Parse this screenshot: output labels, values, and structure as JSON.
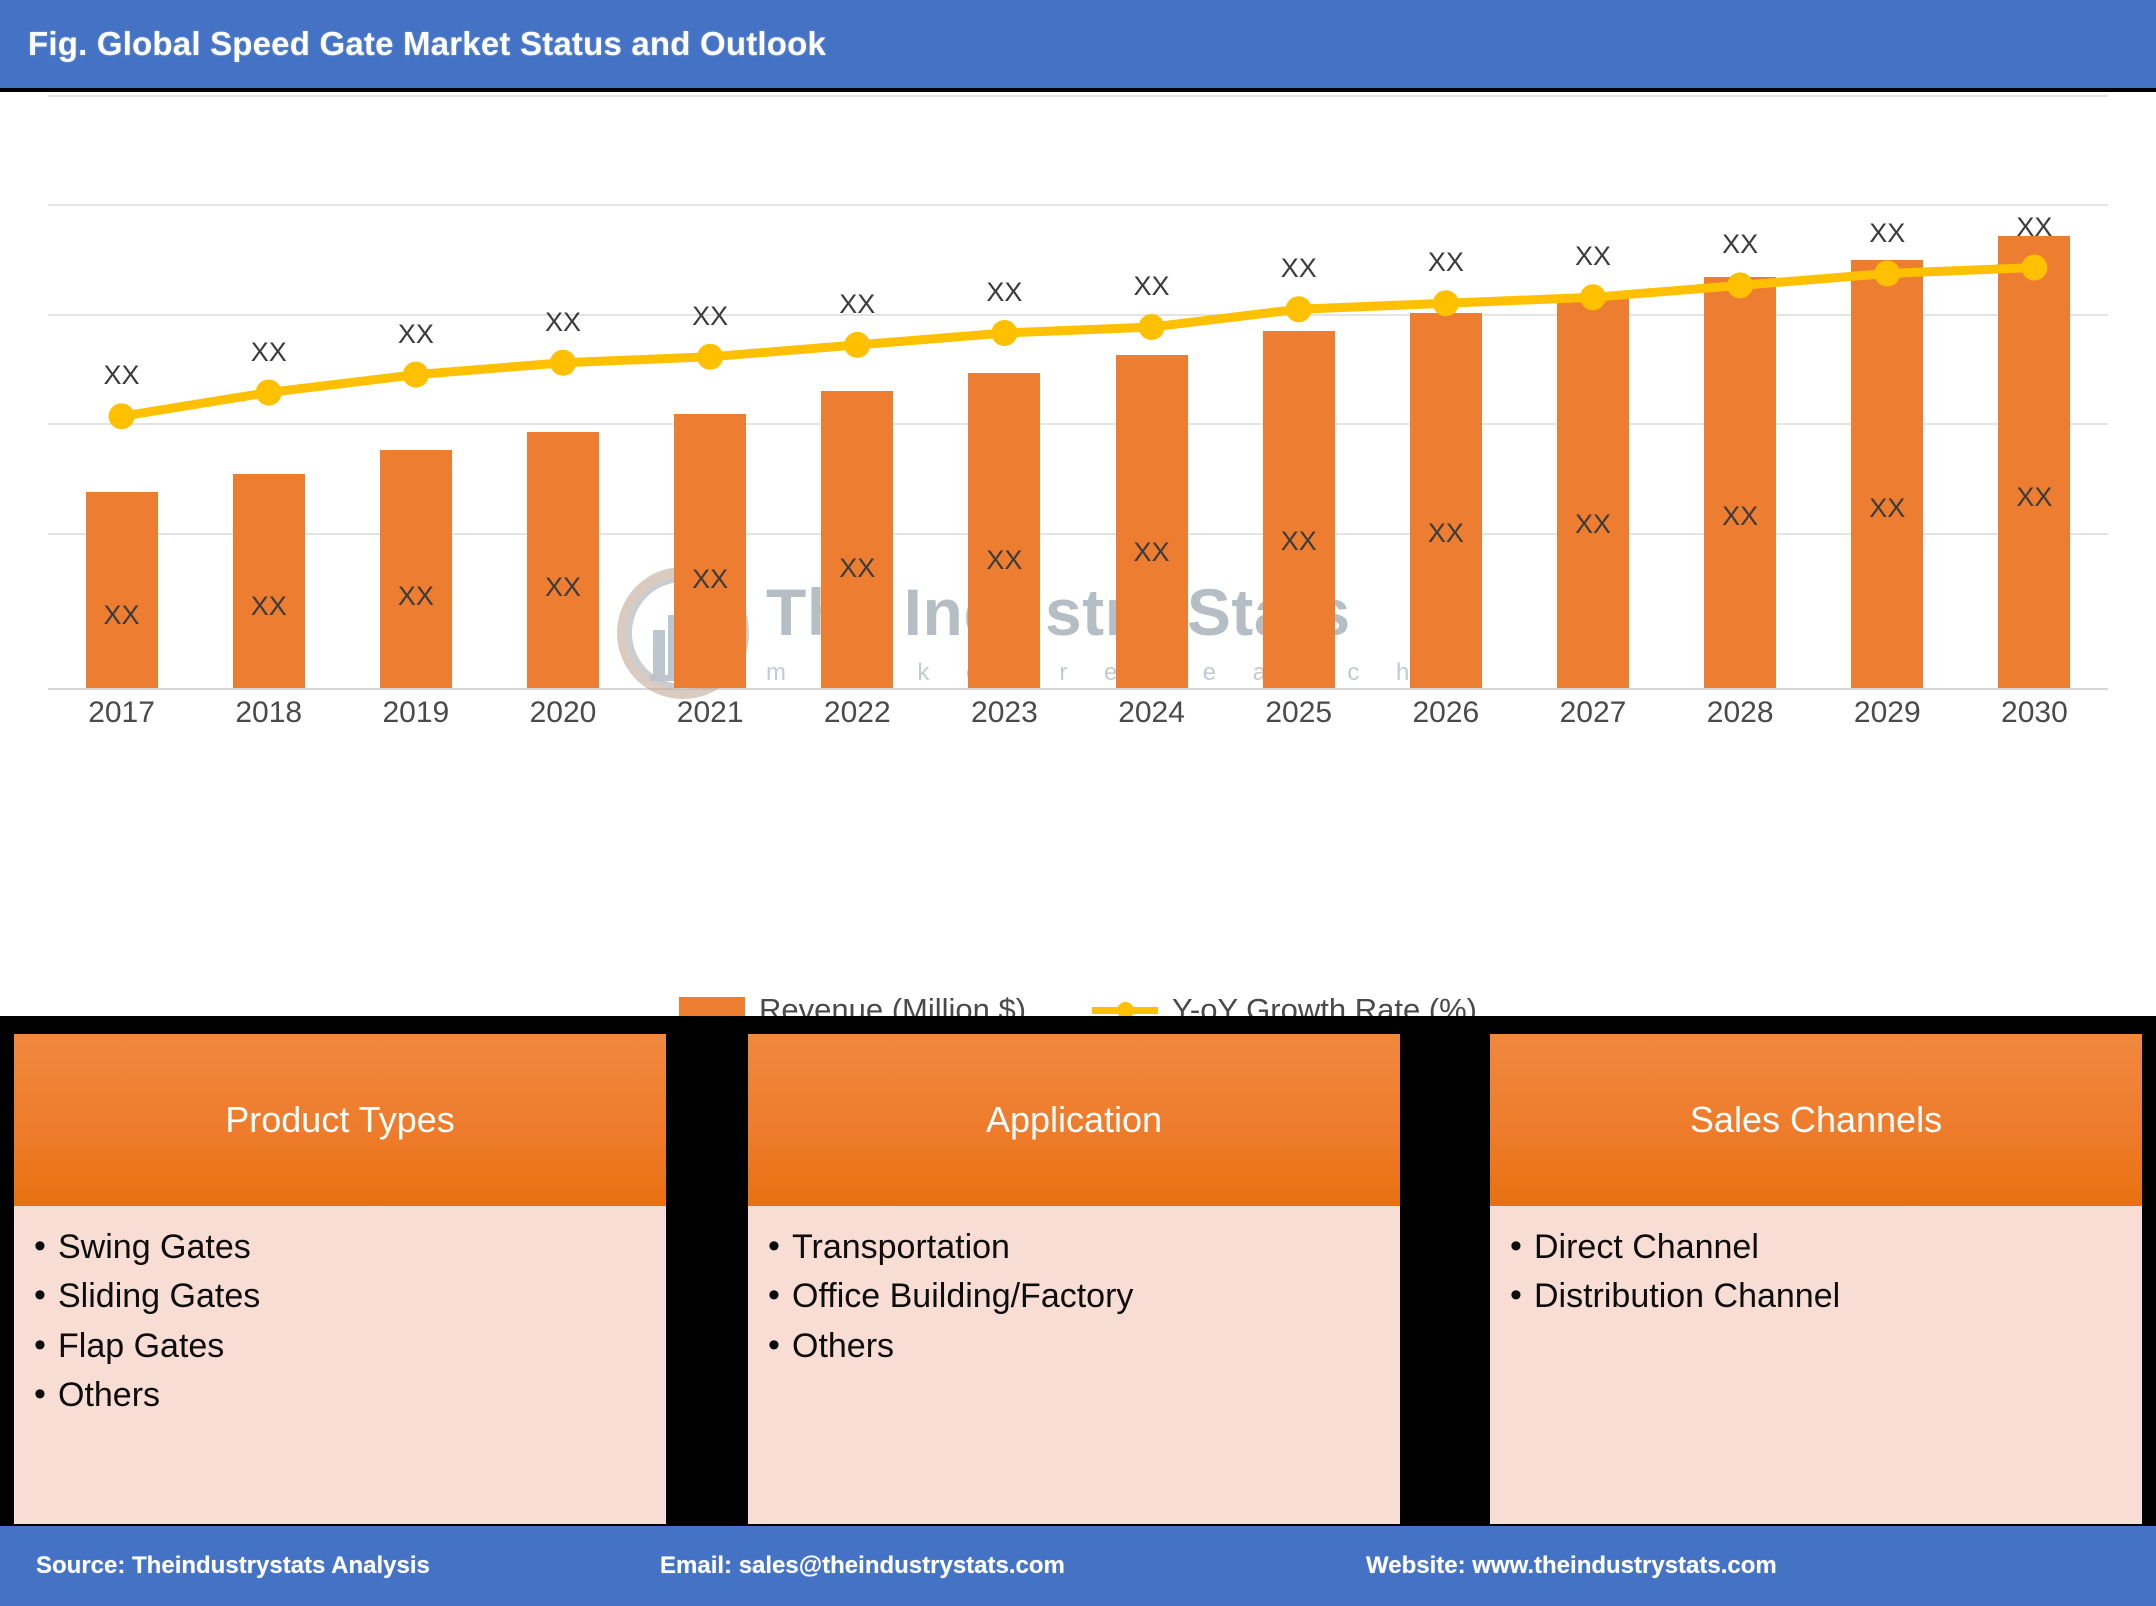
{
  "header": {
    "title": "Fig. Global Speed Gate Market Status and Outlook",
    "bg_color": "#4472C4"
  },
  "watermark": {
    "line1": "The Industry Stats",
    "line2": "m a r k e t   r e s e a r c h"
  },
  "chart_data": {
    "type": "bar",
    "title": "Fig. Global Speed Gate Market Status and Outlook",
    "xlabel": "",
    "ylabel": "",
    "grid": true,
    "legend_position": "bottom",
    "categories": [
      "2017",
      "2018",
      "2019",
      "2020",
      "2021",
      "2022",
      "2023",
      "2024",
      "2025",
      "2026",
      "2027",
      "2028",
      "2029",
      "2030"
    ],
    "bar_color": "#ED7D31",
    "line_color": "#FFC000",
    "series": [
      {
        "name": "Revenue (Million $)",
        "type": "bar",
        "color": "#ED7D31",
        "values": [
          33,
          36,
          40,
          43,
          46,
          50,
          53,
          56,
          60,
          63,
          66,
          69,
          72,
          76
        ],
        "data_labels": [
          "XX",
          "XX",
          "XX",
          "XX",
          "XX",
          "XX",
          "XX",
          "XX",
          "XX",
          "XX",
          "XX",
          "XX",
          "XX",
          "XX"
        ]
      },
      {
        "name": "Y-oY Growth Rate (%)",
        "type": "line",
        "color": "#FFC000",
        "values": [
          46,
          50,
          53,
          55,
          56,
          58,
          60,
          61,
          64,
          65,
          66,
          68,
          70,
          71
        ],
        "data_labels": [
          "XX",
          "XX",
          "XX",
          "XX",
          "XX",
          "XX",
          "XX",
          "XX",
          "XX",
          "XX",
          "XX",
          "XX",
          "XX",
          "XX"
        ]
      }
    ],
    "legend": [
      "Revenue (Million $)",
      "Y-oY Growth Rate (%)"
    ]
  },
  "cards": [
    {
      "title": "Product Types",
      "items": [
        "Swing Gates",
        "Sliding Gates",
        "Flap Gates",
        "Others"
      ]
    },
    {
      "title": "Application",
      "items": [
        "Transportation",
        "Office Building/Factory",
        "Others"
      ]
    },
    {
      "title": "Sales Channels",
      "items": [
        "Direct Channel",
        "Distribution Channel"
      ]
    }
  ],
  "footer": {
    "source": "Source: Theindustrystats Analysis",
    "email": "Email: sales@theindustrystats.com",
    "website": "Website: www.theindustrystats.com",
    "bg_color": "#4472C4"
  }
}
